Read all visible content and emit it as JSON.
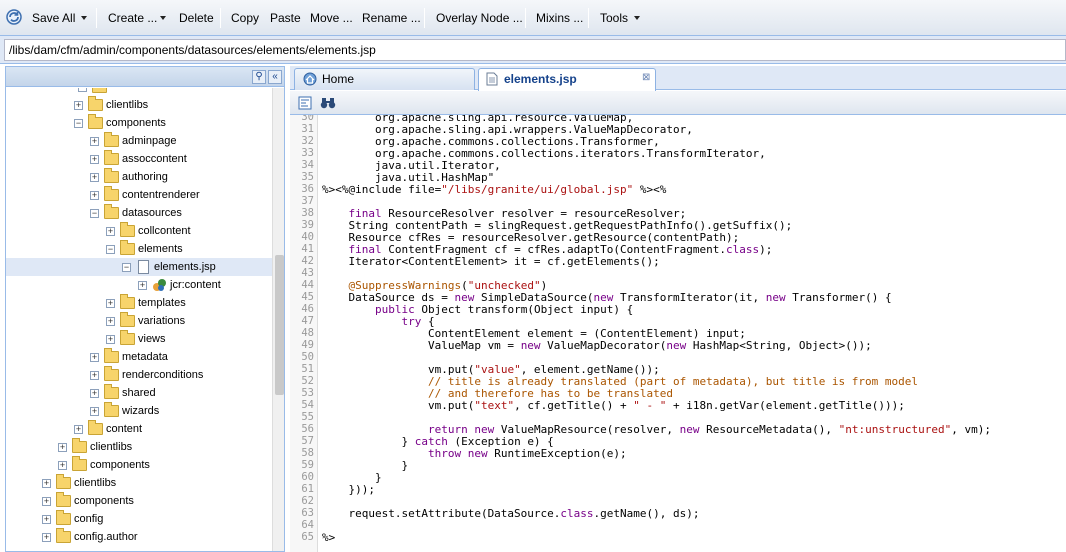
{
  "toolbar": {
    "save_all": "Save All",
    "create": "Create ...",
    "delete": "Delete",
    "copy": "Copy",
    "paste": "Paste",
    "move": "Move ...",
    "rename": "Rename ...",
    "overlay": "Overlay Node ...",
    "mixins": "Mixins ...",
    "tools": "Tools"
  },
  "path": "/libs/dam/cfm/admin/components/datasources/elements/elements.jsp",
  "tree": [
    {
      "label": "clientlibs",
      "depth": 5,
      "icon": "folder",
      "exp": "+"
    },
    {
      "label": "components",
      "depth": 5,
      "icon": "folder",
      "exp": "-"
    },
    {
      "label": "adminpage",
      "depth": 6,
      "icon": "folder",
      "exp": "+"
    },
    {
      "label": "assoccontent",
      "depth": 6,
      "icon": "folder",
      "exp": "+"
    },
    {
      "label": "authoring",
      "depth": 6,
      "icon": "folder",
      "exp": "+"
    },
    {
      "label": "contentrenderer",
      "depth": 6,
      "icon": "folder",
      "exp": "+"
    },
    {
      "label": "datasources",
      "depth": 6,
      "icon": "folder",
      "exp": "-"
    },
    {
      "label": "collcontent",
      "depth": 7,
      "icon": "folder",
      "exp": "+"
    },
    {
      "label": "elements",
      "depth": 7,
      "icon": "folder",
      "exp": "-"
    },
    {
      "label": "elements.jsp",
      "depth": 8,
      "icon": "file",
      "exp": "-",
      "selected": true
    },
    {
      "label": "jcr:content",
      "depth": 9,
      "icon": "jcr",
      "exp": "+"
    },
    {
      "label": "templates",
      "depth": 7,
      "icon": "folder",
      "exp": "+"
    },
    {
      "label": "variations",
      "depth": 7,
      "icon": "folder",
      "exp": "+"
    },
    {
      "label": "views",
      "depth": 7,
      "icon": "folder",
      "exp": "+"
    },
    {
      "label": "metadata",
      "depth": 6,
      "icon": "folder",
      "exp": "+"
    },
    {
      "label": "renderconditions",
      "depth": 6,
      "icon": "folder",
      "exp": "+"
    },
    {
      "label": "shared",
      "depth": 6,
      "icon": "folder",
      "exp": "+"
    },
    {
      "label": "wizards",
      "depth": 6,
      "icon": "folder",
      "exp": "+"
    },
    {
      "label": "content",
      "depth": 5,
      "icon": "folder",
      "exp": "+"
    },
    {
      "label": "clientlibs",
      "depth": 4,
      "icon": "folder",
      "exp": "+"
    },
    {
      "label": "components",
      "depth": 4,
      "icon": "folder",
      "exp": "+"
    },
    {
      "label": "clientlibs",
      "depth": 3,
      "icon": "folder",
      "exp": "+"
    },
    {
      "label": "components",
      "depth": 3,
      "icon": "folder",
      "exp": "+"
    },
    {
      "label": "config",
      "depth": 3,
      "icon": "folder",
      "exp": "+"
    },
    {
      "label": "config.author",
      "depth": 3,
      "icon": "folder",
      "exp": "+"
    }
  ],
  "tabs": [
    {
      "label": "Home",
      "icon": "home-icon"
    },
    {
      "label": "elements.jsp",
      "icon": "file-icon"
    }
  ],
  "code": {
    "first_line": 30,
    "lines": [
      "        org.apache.sling.api.resource.ValueMap,",
      "        org.apache.sling.api.wrappers.ValueMapDecorator,",
      "        org.apache.commons.collections.Transformer,",
      "        org.apache.commons.collections.iterators.TransformIterator,",
      "        java.util.Iterator,",
      "        java.util.HashMap\"",
      "%><%@include file=\"/libs/granite/ui/global.jsp\" %><%",
      "",
      "    final ResourceResolver resolver = resourceResolver;",
      "    String contentPath = slingRequest.getRequestPathInfo().getSuffix();",
      "    Resource cfRes = resourceResolver.getResource(contentPath);",
      "    final ContentFragment cf = cfRes.adaptTo(ContentFragment.class);",
      "    Iterator<ContentElement> it = cf.getElements();",
      "",
      "    @SuppressWarnings(\"unchecked\")",
      "    DataSource ds = new SimpleDataSource(new TransformIterator(it, new Transformer() {",
      "        public Object transform(Object input) {",
      "            try {",
      "                ContentElement element = (ContentElement) input;",
      "                ValueMap vm = new ValueMapDecorator(new HashMap<String, Object>());",
      "",
      "                vm.put(\"value\", element.getName());",
      "                // title is already translated (part of metadata), but title is from model",
      "                // and therefore has to be translated",
      "                vm.put(\"text\", cf.getTitle() + \" - \" + i18n.getVar(element.getTitle()));",
      "",
      "                return new ValueMapResource(resolver, new ResourceMetadata(), \"nt:unstructured\", vm);",
      "            } catch (Exception e) {",
      "                throw new RuntimeException(e);",
      "            }",
      "        }",
      "    }));",
      "",
      "    request.setAttribute(DataSource.class.getName(), ds);",
      "",
      "%>"
    ]
  }
}
